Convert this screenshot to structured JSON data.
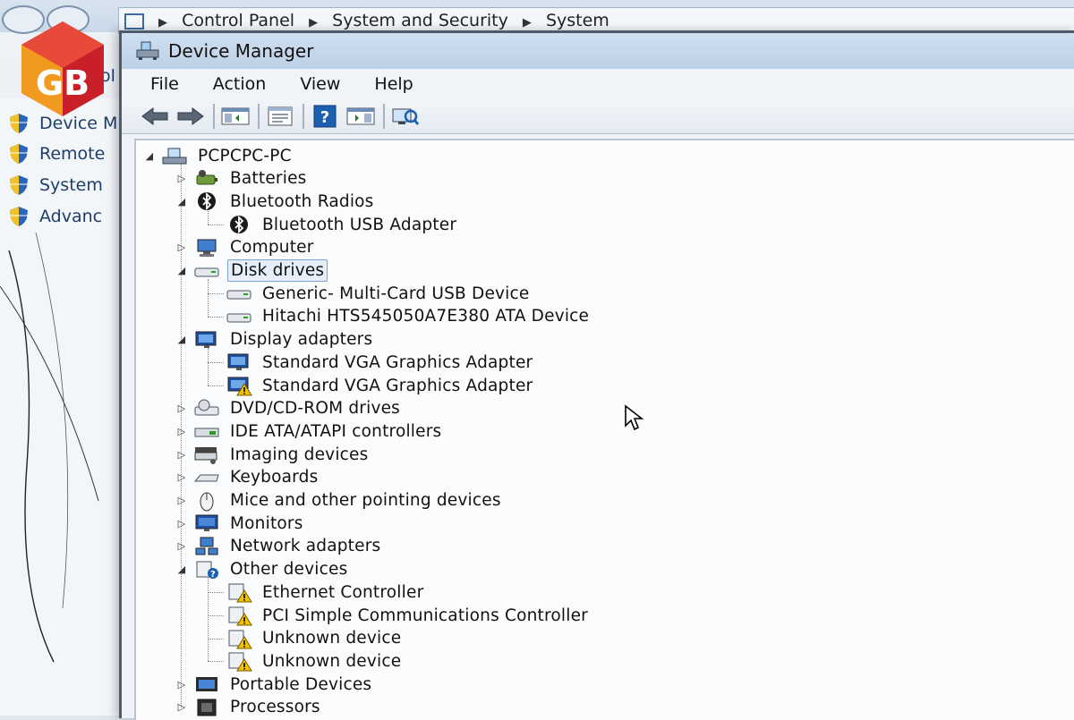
{
  "breadcrumb": [
    "Control Panel",
    "System and Security",
    "System"
  ],
  "logo_text": "GB",
  "sidebar_partial_text": "ol",
  "sidebar": [
    "Device M",
    "Remote",
    "System",
    "Advanc"
  ],
  "window": {
    "title": "Device Manager"
  },
  "menu": [
    "File",
    "Action",
    "View",
    "Help"
  ],
  "toolbar": [
    "back-icon",
    "forward-icon",
    "show-hide-console-tree-icon",
    "properties-icon",
    "help-icon",
    "action-pane-icon",
    "scan-hardware-icon"
  ],
  "tree": {
    "root": "PCPCPC-PC",
    "categories": [
      {
        "label": "Batteries",
        "expanded": false,
        "icon": "battery-icon"
      },
      {
        "label": "Bluetooth Radios",
        "expanded": true,
        "icon": "bluetooth-icon",
        "children": [
          {
            "label": "Bluetooth USB Adapter",
            "icon": "bluetooth-adapter-icon"
          }
        ]
      },
      {
        "label": "Computer",
        "expanded": false,
        "icon": "computer-icon"
      },
      {
        "label": "Disk drives",
        "expanded": true,
        "selected": true,
        "icon": "disk-drive-icon",
        "children": [
          {
            "label": "Generic- Multi-Card USB Device",
            "icon": "disk-drive-icon"
          },
          {
            "label": "Hitachi HTS545050A7E380 ATA Device",
            "icon": "disk-drive-icon"
          }
        ]
      },
      {
        "label": "Display adapters",
        "expanded": true,
        "icon": "display-adapter-icon",
        "children": [
          {
            "label": "Standard VGA Graphics Adapter",
            "icon": "display-adapter-icon"
          },
          {
            "label": "Standard VGA Graphics Adapter",
            "icon": "display-adapter-warning-icon",
            "warning": true
          }
        ]
      },
      {
        "label": "DVD/CD-ROM drives",
        "expanded": false,
        "icon": "dvd-drive-icon"
      },
      {
        "label": "IDE ATA/ATAPI controllers",
        "expanded": false,
        "icon": "ide-controller-icon"
      },
      {
        "label": "Imaging devices",
        "expanded": false,
        "icon": "imaging-device-icon"
      },
      {
        "label": "Keyboards",
        "expanded": false,
        "icon": "keyboard-icon"
      },
      {
        "label": "Mice and other pointing devices",
        "expanded": false,
        "icon": "mouse-icon"
      },
      {
        "label": "Monitors",
        "expanded": false,
        "icon": "monitor-icon"
      },
      {
        "label": "Network adapters",
        "expanded": false,
        "icon": "network-adapter-icon"
      },
      {
        "label": "Other devices",
        "expanded": true,
        "icon": "other-devices-icon",
        "children": [
          {
            "label": "Ethernet Controller",
            "icon": "unknown-device-warning-icon",
            "warning": true
          },
          {
            "label": "PCI Simple Communications Controller",
            "icon": "unknown-device-warning-icon",
            "warning": true
          },
          {
            "label": "Unknown device",
            "icon": "unknown-device-warning-icon",
            "warning": true
          },
          {
            "label": "Unknown device",
            "icon": "unknown-device-warning-icon",
            "warning": true
          }
        ]
      },
      {
        "label": "Portable Devices",
        "expanded": false,
        "icon": "portable-device-icon"
      },
      {
        "label": "Processors",
        "expanded": false,
        "icon": "processor-icon"
      }
    ]
  },
  "colors": {
    "accent": "#1c5fb0",
    "warning": "#f2c200",
    "selection": "#e5eef9",
    "logo_red": "#d8262d",
    "logo_orange": "#f29a1f"
  }
}
